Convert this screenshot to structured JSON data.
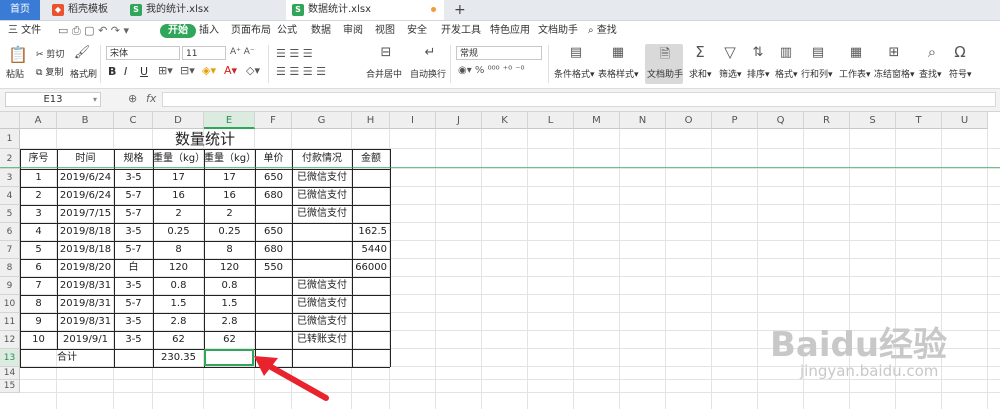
{
  "tabs": {
    "home": "首页",
    "items": [
      {
        "label": "稻壳模板",
        "icon": "docer-icon"
      },
      {
        "label": "我的统计.xlsx",
        "icon": "sheet-icon"
      },
      {
        "label": "数据统计.xlsx",
        "icon": "sheet-icon",
        "active": true
      }
    ],
    "new_tab": "+"
  },
  "menu": {
    "file": "三 文件",
    "items": [
      "开始",
      "插入",
      "页面布局",
      "公式",
      "数据",
      "审阅",
      "视图",
      "安全",
      "开发工具",
      "特色应用",
      "文档助手"
    ],
    "search": "查找"
  },
  "ribbon": {
    "paste": "粘贴",
    "cut": "剪切",
    "copy": "复制",
    "format_painter": "格式刷",
    "font_name": "宋体",
    "font_size": "11",
    "merge_center": "合并居中",
    "wrap_text": "自动换行",
    "number_format": "常规",
    "cond_format": "条件格式",
    "table_style": "表格样式",
    "doc_helper": "文档助手",
    "sum": "求和",
    "filter": "筛选",
    "sort": "排序",
    "format": "格式",
    "row_col": "行和列",
    "worksheet": "工作表",
    "freeze": "冻结窗格",
    "find": "查找",
    "symbol": "符号",
    "bold": "B",
    "italic": "I",
    "underline": "U"
  },
  "formula_bar": {
    "cell_ref": "E13",
    "fx": "fx",
    "value": ""
  },
  "columns": [
    "A",
    "B",
    "C",
    "D",
    "E",
    "F",
    "G",
    "H",
    "I",
    "J",
    "K",
    "L",
    "M",
    "N",
    "O",
    "P",
    "Q",
    "R",
    "S",
    "T",
    "U"
  ],
  "rows": [
    "1",
    "2",
    "3",
    "4",
    "5",
    "6",
    "7",
    "8",
    "9",
    "10",
    "11",
    "12",
    "13",
    "14",
    "15"
  ],
  "sheet": {
    "title": "数量统计",
    "headers": [
      "序号",
      "时间",
      "规格",
      "重量（kg）",
      "重量（kg）",
      "单价",
      "付款情况",
      "金额"
    ],
    "data": [
      [
        "1",
        "2019/6/24",
        "3-5",
        "17",
        "17",
        "650",
        "已微信支付",
        ""
      ],
      [
        "2",
        "2019/6/24",
        "5-7",
        "16",
        "16",
        "680",
        "已微信支付",
        ""
      ],
      [
        "3",
        "2019/7/15",
        "5-7",
        "2",
        "2",
        "",
        "已微信支付",
        ""
      ],
      [
        "4",
        "2019/8/18",
        "3-5",
        "0.25",
        "0.25",
        "650",
        "",
        "162.5"
      ],
      [
        "5",
        "2019/8/18",
        "5-7",
        "8",
        "8",
        "680",
        "",
        "5440"
      ],
      [
        "6",
        "2019/8/20",
        "白",
        "120",
        "120",
        "550",
        "",
        "66000"
      ],
      [
        "7",
        "2019/8/31",
        "3-5",
        "0.8",
        "0.8",
        "",
        "已微信支付",
        ""
      ],
      [
        "8",
        "2019/8/31",
        "5-7",
        "1.5",
        "1.5",
        "",
        "已微信支付",
        ""
      ],
      [
        "9",
        "2019/8/31",
        "3-5",
        "2.8",
        "2.8",
        "",
        "已微信支付",
        ""
      ],
      [
        "10",
        "2019/9/1",
        "3-5",
        "62",
        "62",
        "",
        "已转账支付",
        ""
      ]
    ],
    "total_label": "合计",
    "total_value": "230.35"
  },
  "watermark": {
    "main": "Baidu经验",
    "sub": "jingyan.baidu.com"
  },
  "colors": {
    "accent_green": "#2fa659",
    "home_tab": "#3a7bd5",
    "arrow_red": "#e8232e"
  }
}
